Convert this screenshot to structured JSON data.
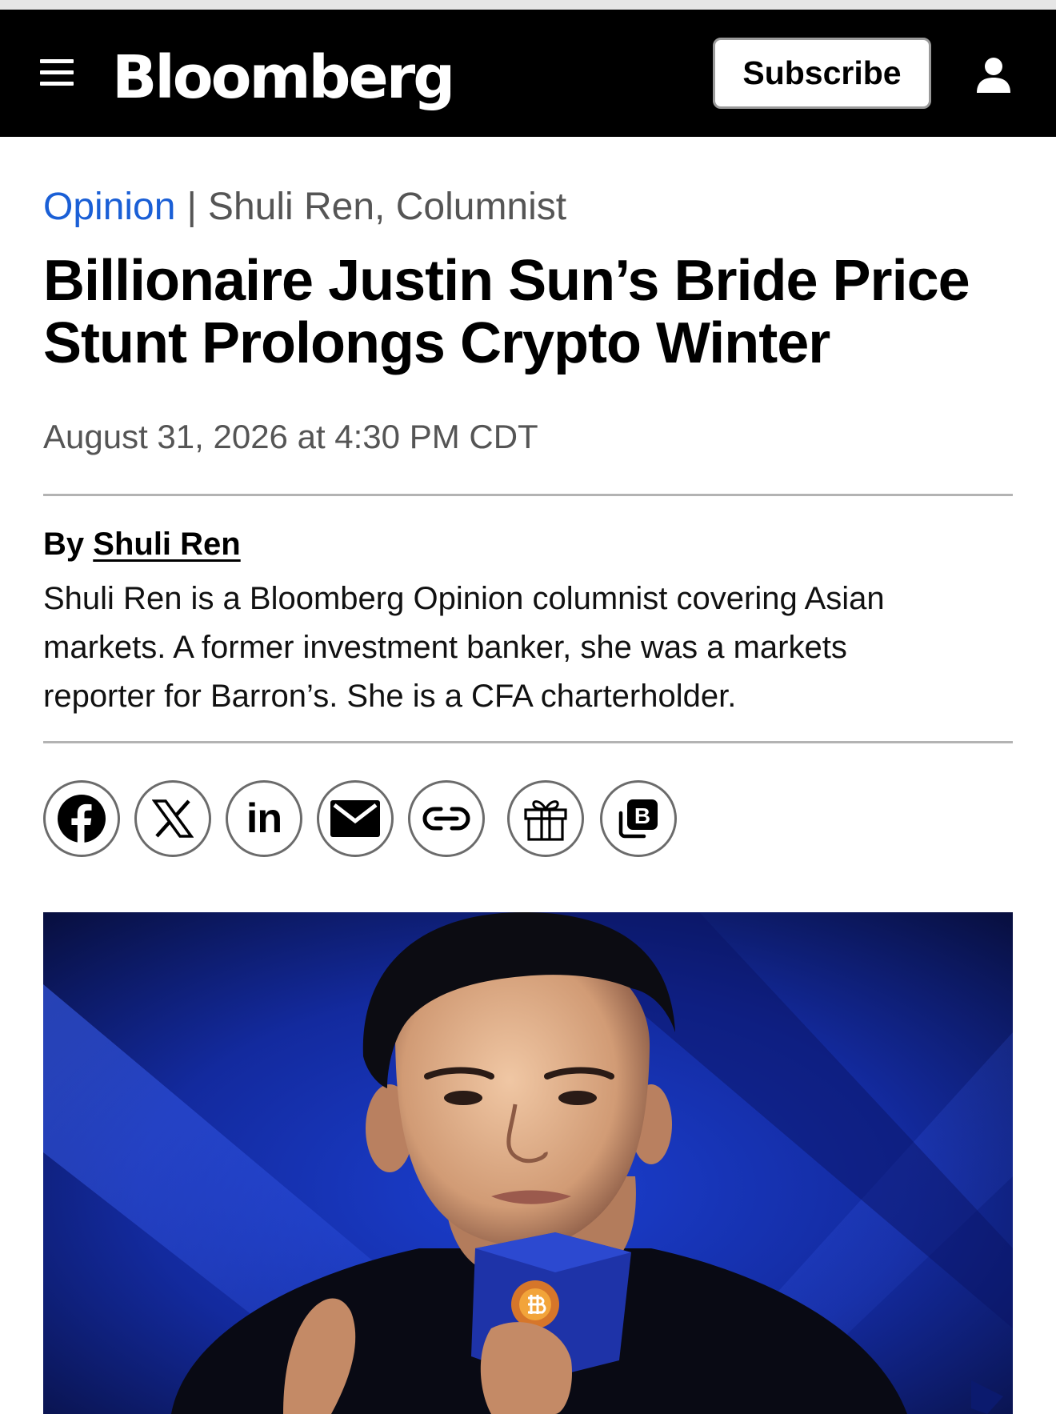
{
  "header": {
    "logo_text": "Bloomberg",
    "subscribe_label": "Subscribe",
    "menu_icon": "hamburger-menu-icon",
    "account_icon": "user-icon"
  },
  "article": {
    "section": "Opinion",
    "separator": "|",
    "author_kicker": "Shuli Ren, Columnist",
    "headline_lines": [
      "Billionaire Justin Sun’s Bride Price",
      "Stunt Prolongs Crypto Winter"
    ],
    "dateline": "August 31, 2026 at 4:30 PM CDT",
    "byline_prefix": "By",
    "byline_author": "Shuli Ren",
    "bio_lines": [
      "Shuli Ren is a Bloomberg Opinion columnist covering Asian",
      "markets. A former investment banker, she was a markets",
      "reporter for Barron’s. She is a CFA charterholder."
    ]
  },
  "share": {
    "icons": [
      "facebook-icon",
      "x-icon",
      "linkedin-icon",
      "email-icon",
      "link-icon",
      "gift-icon",
      "bloomberg-app-icon"
    ],
    "linkedin_text": "in",
    "bloomberg_letter": "B"
  },
  "colors": {
    "nav_bg": "#000000",
    "opinion_blue": "#1a5fd6",
    "meta_gray": "#555555",
    "rule_gray": "#b3b3b3",
    "hero_blue": "#1530a8"
  }
}
